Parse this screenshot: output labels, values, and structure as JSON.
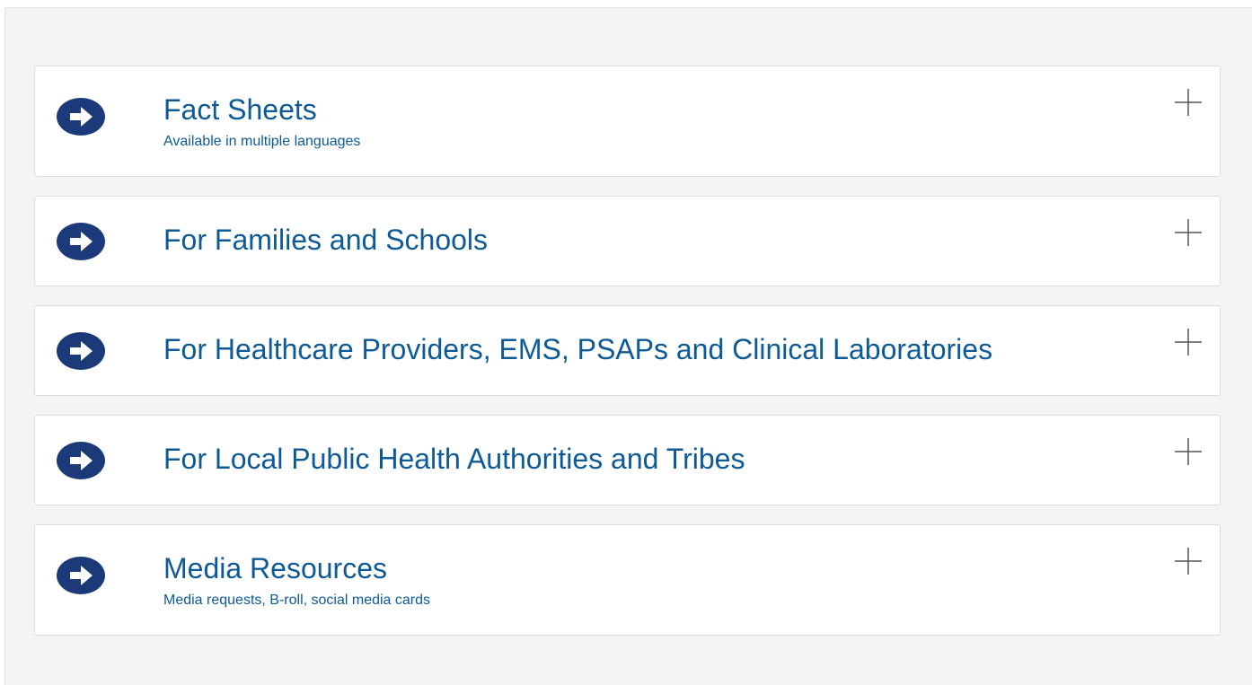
{
  "accordion": {
    "items": [
      {
        "title": "Fact Sheets",
        "subtitle": "Available in multiple languages",
        "icon": "arrow-circle-right-icon",
        "toggle_icon": "plus-icon"
      },
      {
        "title": "For Families and Schools",
        "subtitle": "",
        "icon": "arrow-circle-right-icon",
        "toggle_icon": "plus-icon"
      },
      {
        "title": "For Healthcare Providers, EMS, PSAPs and Clinical Laboratories",
        "subtitle": "",
        "icon": "arrow-circle-right-icon",
        "toggle_icon": "plus-icon"
      },
      {
        "title": "For Local Public Health Authorities and Tribes",
        "subtitle": "",
        "icon": "arrow-circle-right-icon",
        "toggle_icon": "plus-icon"
      },
      {
        "title": "Media Resources",
        "subtitle": "Media requests, B-roll, social media cards",
        "icon": "arrow-circle-right-icon",
        "toggle_icon": "plus-icon"
      }
    ]
  },
  "colors": {
    "panel_background": "#f4f4f4",
    "card_background": "#ffffff",
    "link_blue": "#0e5a96",
    "icon_navy": "#1c3a7a",
    "plus_gray": "#555555"
  }
}
